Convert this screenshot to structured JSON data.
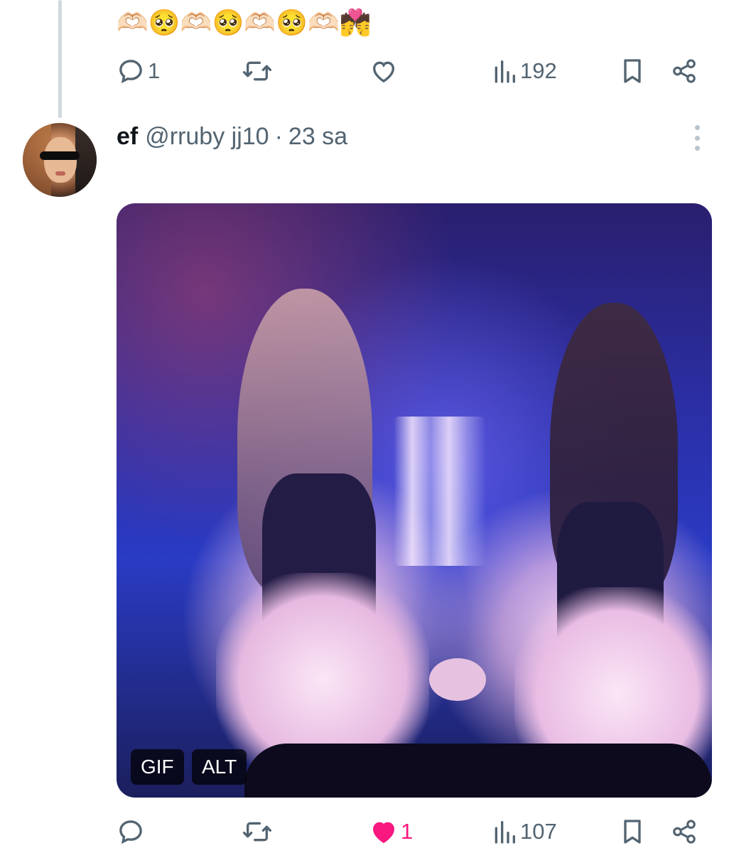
{
  "previous_tweet": {
    "text": "🫶🏻🥺🫶🏻🥺🫶🏻🥺🫶🏻💏",
    "actions": {
      "reply_count": "1",
      "retweet_count": "",
      "like_count": "",
      "views_count": "192"
    }
  },
  "tweet": {
    "author": {
      "name": "ef",
      "handle": "@rruby jj10",
      "separator": "·",
      "time": "23 sa"
    },
    "media": {
      "gif_badge": "GIF",
      "alt_badge": "ALT"
    },
    "actions": {
      "reply_count": "",
      "retweet_count": "",
      "like_count": "1",
      "views_count": "107",
      "liked": true
    }
  },
  "colors": {
    "icon_gray": "#536471",
    "like_pink": "#f91880",
    "thread_line": "#cfd9de"
  },
  "icons": {
    "reply": "speech-bubble-icon",
    "retweet": "retweet-arrows-icon",
    "like": "heart-icon",
    "views": "bar-chart-icon",
    "bookmark": "bookmark-icon",
    "share": "share-nodes-icon",
    "more": "vertical-dots-icon"
  }
}
